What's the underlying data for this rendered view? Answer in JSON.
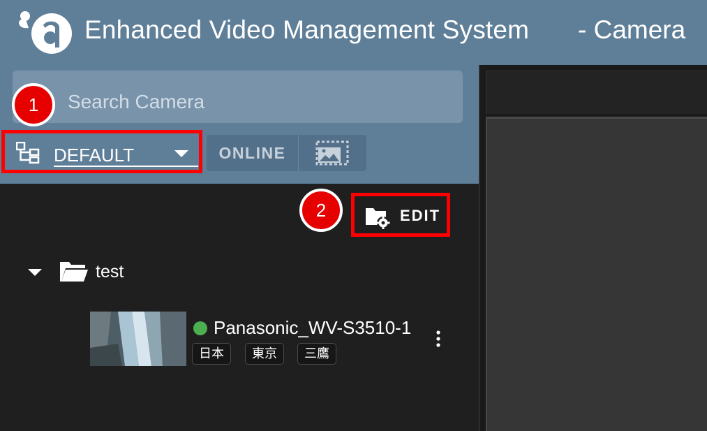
{
  "header": {
    "app_title": "Enhanced Video Management System",
    "page_suffix": "- Camera",
    "logo_icon": "logo-a-icon"
  },
  "search": {
    "placeholder": "Search Camera"
  },
  "tree_select": {
    "value": "DEFAULT",
    "icon": "tree-structure-icon"
  },
  "filters": {
    "online_label": "ONLINE",
    "thumbnail_icon": "image-select-icon"
  },
  "annotations": {
    "badge_1": "1",
    "badge_2": "2"
  },
  "edit_button": {
    "label": "EDIT",
    "icon": "folder-gear-icon"
  },
  "tree": {
    "folder_label": "test",
    "cameras": [
      {
        "name": "Panasonic_WV-S3510-1",
        "status_color": "#4caf50",
        "tags": [
          "日本",
          "東京",
          "三鷹"
        ]
      }
    ]
  },
  "colors": {
    "header_bg": "#5f7f99",
    "panel_bg": "#1f1f1f",
    "highlight_red": "#ff0000",
    "badge_red": "#e60000"
  }
}
